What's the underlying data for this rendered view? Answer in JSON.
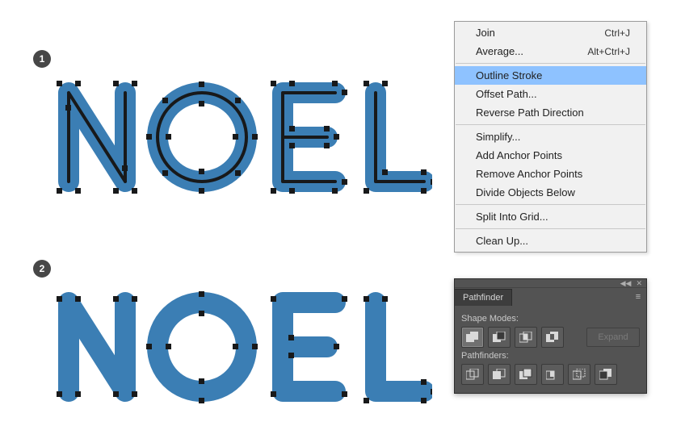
{
  "artwork": {
    "text": "NOEL",
    "fill": "#3b7eb4",
    "stroke": "#18191a"
  },
  "badges": [
    "1",
    "2"
  ],
  "context_menu": {
    "groups": [
      [
        {
          "label": "Join",
          "shortcut": "Ctrl+J"
        },
        {
          "label": "Average...",
          "shortcut": "Alt+Ctrl+J"
        }
      ],
      [
        {
          "label": "Outline Stroke",
          "selected": true
        },
        {
          "label": "Offset Path..."
        },
        {
          "label": "Reverse Path Direction"
        }
      ],
      [
        {
          "label": "Simplify..."
        },
        {
          "label": "Add Anchor Points"
        },
        {
          "label": "Remove Anchor Points"
        },
        {
          "label": "Divide Objects Below"
        }
      ],
      [
        {
          "label": "Split Into Grid..."
        }
      ],
      [
        {
          "label": "Clean Up..."
        }
      ]
    ]
  },
  "pathfinder_panel": {
    "title": "Pathfinder",
    "shape_modes_label": "Shape Modes:",
    "pathfinders_label": "Pathfinders:",
    "expand_label": "Expand",
    "shape_modes": [
      "unite",
      "minus-front",
      "intersect",
      "exclude"
    ],
    "pathfinders": [
      "divide",
      "trim",
      "merge",
      "crop",
      "outline",
      "minus-back"
    ]
  }
}
